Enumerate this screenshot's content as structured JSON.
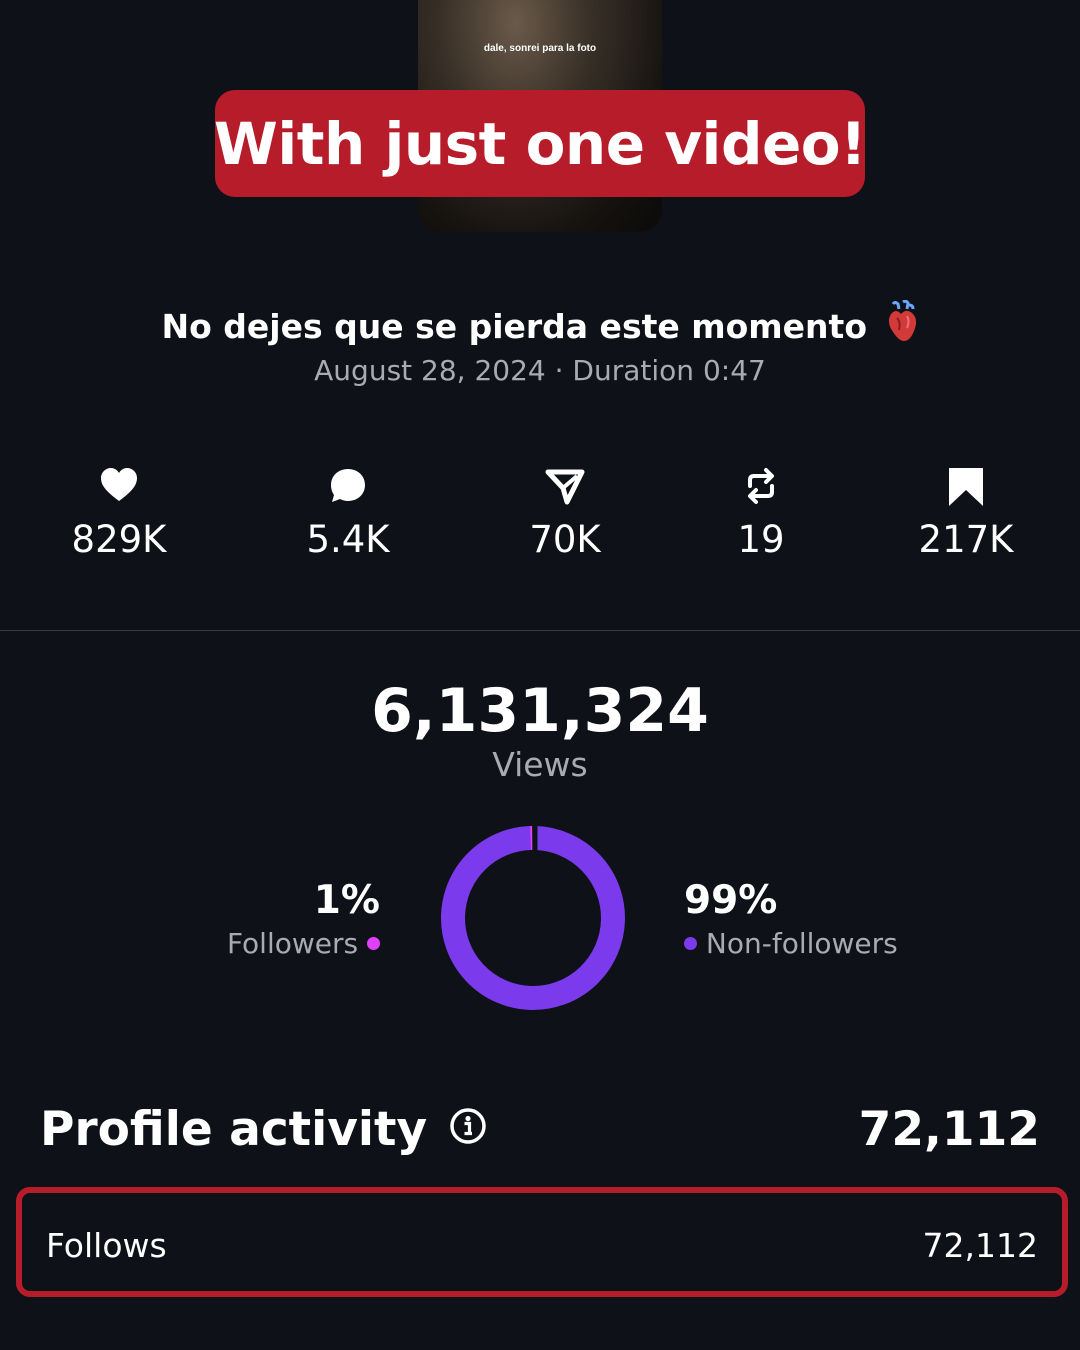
{
  "thumbnail": {
    "caption": "dale, sonrei para la foto"
  },
  "banner": {
    "text": "With just one video!",
    "color": "#b71c2a"
  },
  "video": {
    "title": "No dejes que se pierda este momento",
    "title_emoji": "anatomical-heart-icon",
    "meta": "August 28, 2024 · Duration 0:47"
  },
  "stats": [
    {
      "icon": "heart-icon",
      "value": "829K"
    },
    {
      "icon": "comment-icon",
      "value": "5.4K"
    },
    {
      "icon": "share-icon",
      "value": "70K"
    },
    {
      "icon": "repost-icon",
      "value": "19"
    },
    {
      "icon": "bookmark-icon",
      "value": "217K"
    }
  ],
  "views": {
    "count": "6,131,324",
    "label": "Views"
  },
  "audience": {
    "followers": {
      "percent": "1%",
      "label": "Followers",
      "color": "#e040fb",
      "fraction": 0.01
    },
    "non_followers": {
      "percent": "99%",
      "label": "Non-followers",
      "color": "#7c3aed",
      "fraction": 0.99
    }
  },
  "profile_activity": {
    "title": "Profile activity",
    "total": "72,112",
    "rows": [
      {
        "label": "Follows",
        "value": "72,112"
      }
    ]
  },
  "highlight_color": "#b71c2a"
}
